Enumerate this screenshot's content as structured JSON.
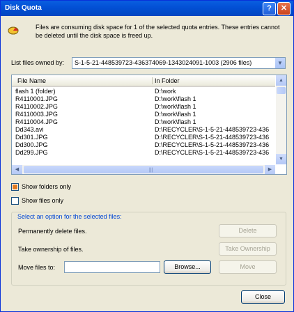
{
  "window": {
    "title": "Disk Quota",
    "help_glyph": "?",
    "close_glyph": "✕"
  },
  "message": "Files are consuming disk space for 1 of the selected quota entries.  These entries cannot be deleted until the disk space is freed up.",
  "owner": {
    "label": "List files owned by:",
    "value": "S-1-5-21-448539723-436374069-1343024091-1003 (2906 files)"
  },
  "list": {
    "columns": [
      "File Name",
      "In Folder"
    ],
    "rows": [
      {
        "name": "flash 1  (folder)",
        "folder": "D:\\work"
      },
      {
        "name": "R4110001.JPG",
        "folder": "D:\\work\\flash 1"
      },
      {
        "name": "R4110002.JPG",
        "folder": "D:\\work\\flash 1"
      },
      {
        "name": "R4110003.JPG",
        "folder": "D:\\work\\flash 1"
      },
      {
        "name": "R4110004.JPG",
        "folder": "D:\\work\\flash 1"
      },
      {
        "name": "Dd343.avi",
        "folder": "D:\\RECYCLER\\S-1-5-21-448539723-436"
      },
      {
        "name": "Dd301.JPG",
        "folder": "D:\\RECYCLER\\S-1-5-21-448539723-436"
      },
      {
        "name": "Dd300.JPG",
        "folder": "D:\\RECYCLER\\S-1-5-21-448539723-436"
      },
      {
        "name": "Dd299.JPG",
        "folder": "D:\\RECYCLER\\S-1-5-21-448539723-436"
      }
    ]
  },
  "options": {
    "show_folders_only": "Show folders only",
    "show_files_only": "Show files only",
    "show_folders_only_checked": true,
    "show_files_only_checked": false
  },
  "actions": {
    "group_label": "Select an option for the selected files:",
    "delete_label": "Permanently delete files.",
    "delete_button": "Delete",
    "ownership_label": "Take ownership of files.",
    "ownership_button": "Take Ownership",
    "move_label": "Move files to:",
    "move_value": "",
    "browse_button": "Browse...",
    "move_button": "Move"
  },
  "footer": {
    "close_button": "Close"
  },
  "icons": {
    "help": "help-icon",
    "close": "close-icon",
    "quota": "disk-quota-icon",
    "dropdown": "chevron-down-icon"
  }
}
